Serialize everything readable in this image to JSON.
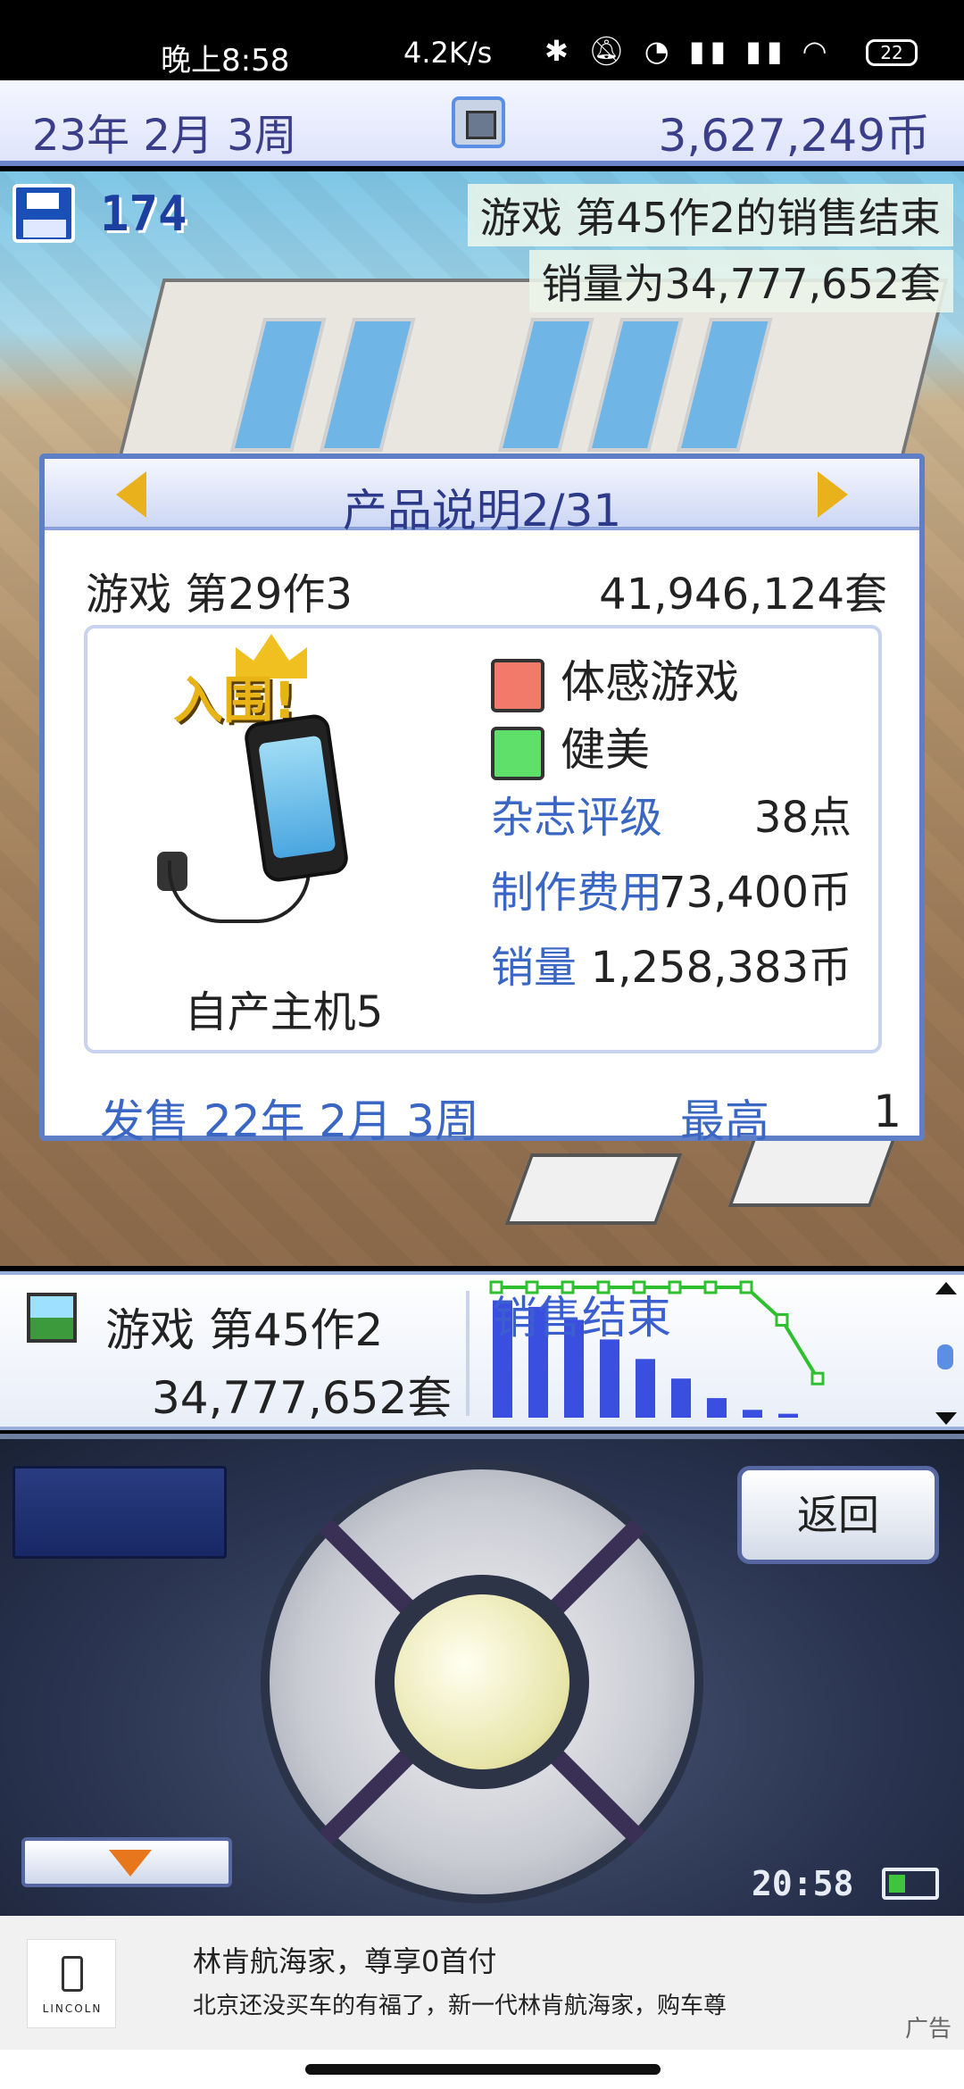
{
  "status_bar": {
    "time": "晚上8:58",
    "network_speed": "4.2K/s",
    "icons": [
      "bluetooth-icon",
      "mute-icon",
      "alarm-icon",
      "signal-icon",
      "signal-icon",
      "wifi-icon"
    ],
    "battery": "22"
  },
  "top_bar": {
    "date": "23年 2月 3周",
    "funds": "3,627,249币"
  },
  "hud": {
    "research_points": "174"
  },
  "notification": {
    "line1": "游戏 第45作2的销售结束",
    "line2": "销量为34,777,652套"
  },
  "product_dialog": {
    "title": "产品说明2/31",
    "product_name": "游戏 第29作3",
    "total_sales": "41,946,124套",
    "ranking_badge": "入围!",
    "console": "自产主机5",
    "genre": "体感游戏",
    "theme": "健美",
    "magazine_rating_label": "杂志评级",
    "magazine_rating_value": "38点",
    "production_cost_label": "制作费用",
    "production_cost_value": "73,400币",
    "sales_label": "销量",
    "sales_value": "1,258,383币",
    "release_label": "发售 22年 2月 3周",
    "best_rank_label": "最高",
    "best_rank_value": "1"
  },
  "info_bar": {
    "game_name": "游戏 第45作2",
    "game_sales": "34,777,652套",
    "chart_status": "销售结束"
  },
  "chart_data": {
    "type": "bar",
    "values": [
      9,
      8.5,
      7.5,
      6,
      4.5,
      3,
      1.5,
      0.6,
      0.3
    ],
    "line_values": [
      10,
      10,
      10,
      10,
      10,
      10,
      10,
      10,
      7.5,
      3
    ],
    "ylim": [
      0,
      10
    ],
    "colors": {
      "bar": "#3a4fe0",
      "line": "#2fc02f"
    }
  },
  "controller": {
    "back_label": "返回",
    "clock": "20:58"
  },
  "ad": {
    "brand": "LINCOLN",
    "title": "林肯航海家，尊享0首付",
    "subtitle": "北京还没买车的有福了，新一代林肯航海家，购车尊",
    "tag": "广告"
  },
  "colors": {
    "accent_blue": "#3a66c4",
    "title_purple": "#3a3e88",
    "gold": "#e7b315"
  }
}
